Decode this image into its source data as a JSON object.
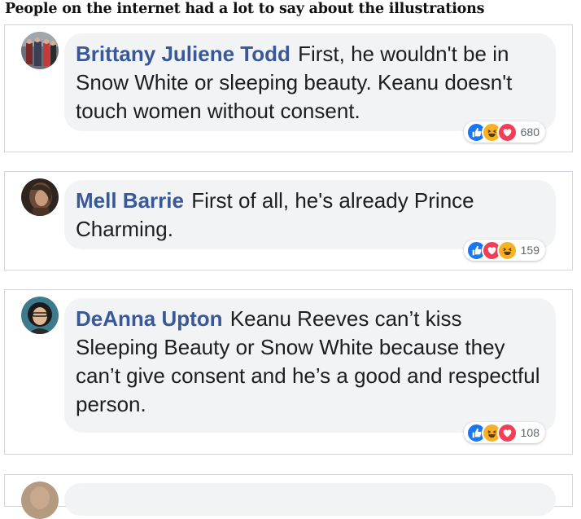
{
  "heading": "People on the internet had a lot to say about the illustrations",
  "comments": [
    {
      "author": "Brittany Juliene Todd",
      "text": "First, he wouldn't be in Snow White or sleeping beauty. Keanu doesn't touch women without consent.",
      "reaction_icons": [
        "like-icon",
        "haha-icon",
        "love-icon"
      ],
      "reaction_count": "680"
    },
    {
      "author": "Mell Barrie",
      "text": "First of all, he's already Prince Charming.",
      "reaction_icons": [
        "like-icon",
        "love-icon",
        "haha-icon"
      ],
      "reaction_count": "159"
    },
    {
      "author": "DeAnna Upton",
      "text": "Keanu Reeves can’t kiss Sleeping Beauty or Snow White because they can’t give consent and he’s a good and respectful person.",
      "reaction_icons": [
        "like-icon",
        "haha-icon",
        "love-icon"
      ],
      "reaction_count": "108"
    }
  ],
  "colors": {
    "author": "#385898",
    "bubble": "#f2f3f5",
    "like": "#1877f2",
    "love": "#f33e58",
    "haha": "#f7b125"
  }
}
